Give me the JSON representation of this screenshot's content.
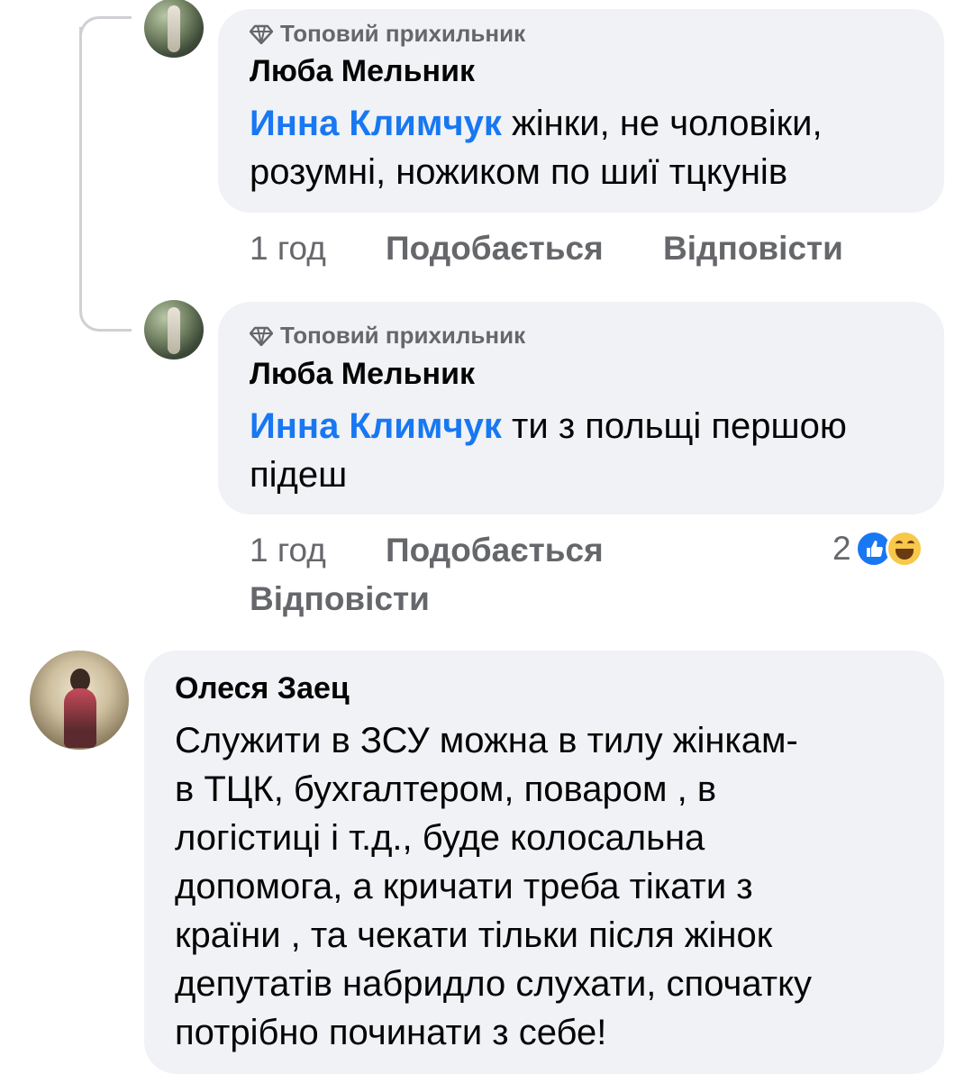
{
  "comments": [
    {
      "badge": "Топовий прихильник",
      "author": "Люба Мельник",
      "mention": "Инна Климчук",
      "text_lines": [
        " жінки, не чоловіки,",
        "розумні, ножиком по шиї тцкунів"
      ],
      "time": "1 год",
      "like": "Подобається",
      "reply": "Відповісти"
    },
    {
      "badge": "Топовий прихильник",
      "author": "Люба Мельник",
      "mention": "Инна Климчук",
      "text_lines": [
        " ти з польщі першою",
        "підеш"
      ],
      "time": "1 год",
      "like": "Подобається",
      "reply": "Відповісти",
      "reaction_count": "2",
      "reaction_icons": [
        "like-icon",
        "haha-icon"
      ]
    },
    {
      "author": "Олеся Заец",
      "text_lines": [
        "Служити  в ЗСУ можна в тилу жінкам-",
        "в ТЦК, бухгалтером, поваром , в",
        "логістиці і т.д., буде колосальна",
        "допомога, а кричати треба тікати з",
        "країни , та чекати тільки після жінок",
        "депутатів набридло слухати, спочатку",
        "потрібно починати з себе!"
      ]
    }
  ],
  "colors": {
    "bubble": "#f0f2f5",
    "mention": "#1877f2",
    "secondary_text": "#65676b",
    "thread_line": "#ced0d4"
  }
}
